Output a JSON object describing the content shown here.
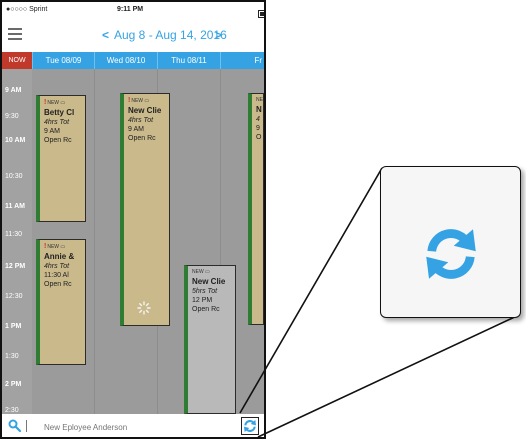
{
  "status_bar": {
    "carrier": "●○○○○ Sprint",
    "time": "9:11 PM"
  },
  "nav": {
    "date_range": "Aug 8 - Aug 14, 2016",
    "prev": "<",
    "next": ">",
    "menu_icon": "hamburger-icon"
  },
  "day_header": {
    "now_label": "NOW",
    "days": [
      "Tue 08/09",
      "Wed 08/10",
      "Thu 08/11",
      "Fr"
    ]
  },
  "time_labels": [
    "9 AM",
    "9:30",
    "10 AM",
    "10:30",
    "11 AM",
    "11:30",
    "12 PM",
    "12:30",
    "1 PM",
    "1:30",
    "2 PM",
    "2:30"
  ],
  "events": [
    {
      "tag": "NEW",
      "name": "Betty Cl",
      "duration": "4hrs Tot",
      "time": "9 AM",
      "status": "Open Rc"
    },
    {
      "tag": "NEW",
      "name": "New Clie",
      "duration": "4hrs Tot",
      "time": "9 AM",
      "status": "Open Rc"
    },
    {
      "tag": "NEW",
      "name": "Annie &",
      "duration": "4hrs Tot",
      "time": "11:30 Al",
      "status": "Open Rc"
    },
    {
      "tag": "NEW",
      "name": "New Clie",
      "duration": "5hrs Tot",
      "time": "12 PM",
      "status": "Open Rc"
    },
    {
      "tag": "NE",
      "name": "N",
      "duration": "4",
      "time": "9",
      "status": "O"
    }
  ],
  "bottom_bar": {
    "employee_placeholder": "New Eployee Anderson",
    "search_icon": "search-icon",
    "refresh_icon": "refresh-icon"
  },
  "colors": {
    "accent": "#35a3e3",
    "now": "#c0392b",
    "event_tan": "#c9b98b",
    "event_gray": "#b9b9b9",
    "event_border": "#2e7d32"
  }
}
